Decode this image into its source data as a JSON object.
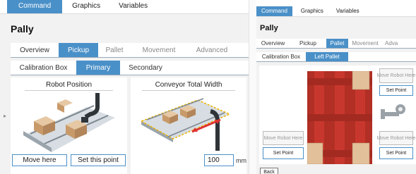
{
  "left": {
    "top_tabs": [
      "Command",
      "Graphics",
      "Variables"
    ],
    "title": "Pally",
    "main_tabs": [
      "Overview",
      "Pickup",
      "Pallet",
      "Movement",
      "Advanced"
    ],
    "sub_tabs": [
      "Calibration Box",
      "Primary",
      "Secondary"
    ],
    "robot_position": {
      "title": "Robot Position",
      "move_button": "Move here",
      "set_button": "Set this point"
    },
    "conveyor": {
      "title": "Conveyor Total Width",
      "value": "100",
      "unit": "mm"
    }
  },
  "right": {
    "top_tabs": [
      "Command",
      "Graphics",
      "Variables"
    ],
    "title": "Pally",
    "main_tabs": [
      "Overview",
      "Pickup",
      "Pallet",
      "Movement",
      "Adva"
    ],
    "sub_tabs": [
      "Calibration Box",
      "Left Pallet"
    ],
    "move_robot_label": "Move Robot Here",
    "set_point_label": "Set Point",
    "back_label": "Back"
  },
  "colors": {
    "accent": "#4a90c8",
    "pallet": "#c8372d",
    "box": "#d9b48a"
  },
  "icons": [
    "collapse-arrow-icon",
    "robot-arm-icon",
    "conveyor-illustration",
    "pallet-illustration"
  ]
}
